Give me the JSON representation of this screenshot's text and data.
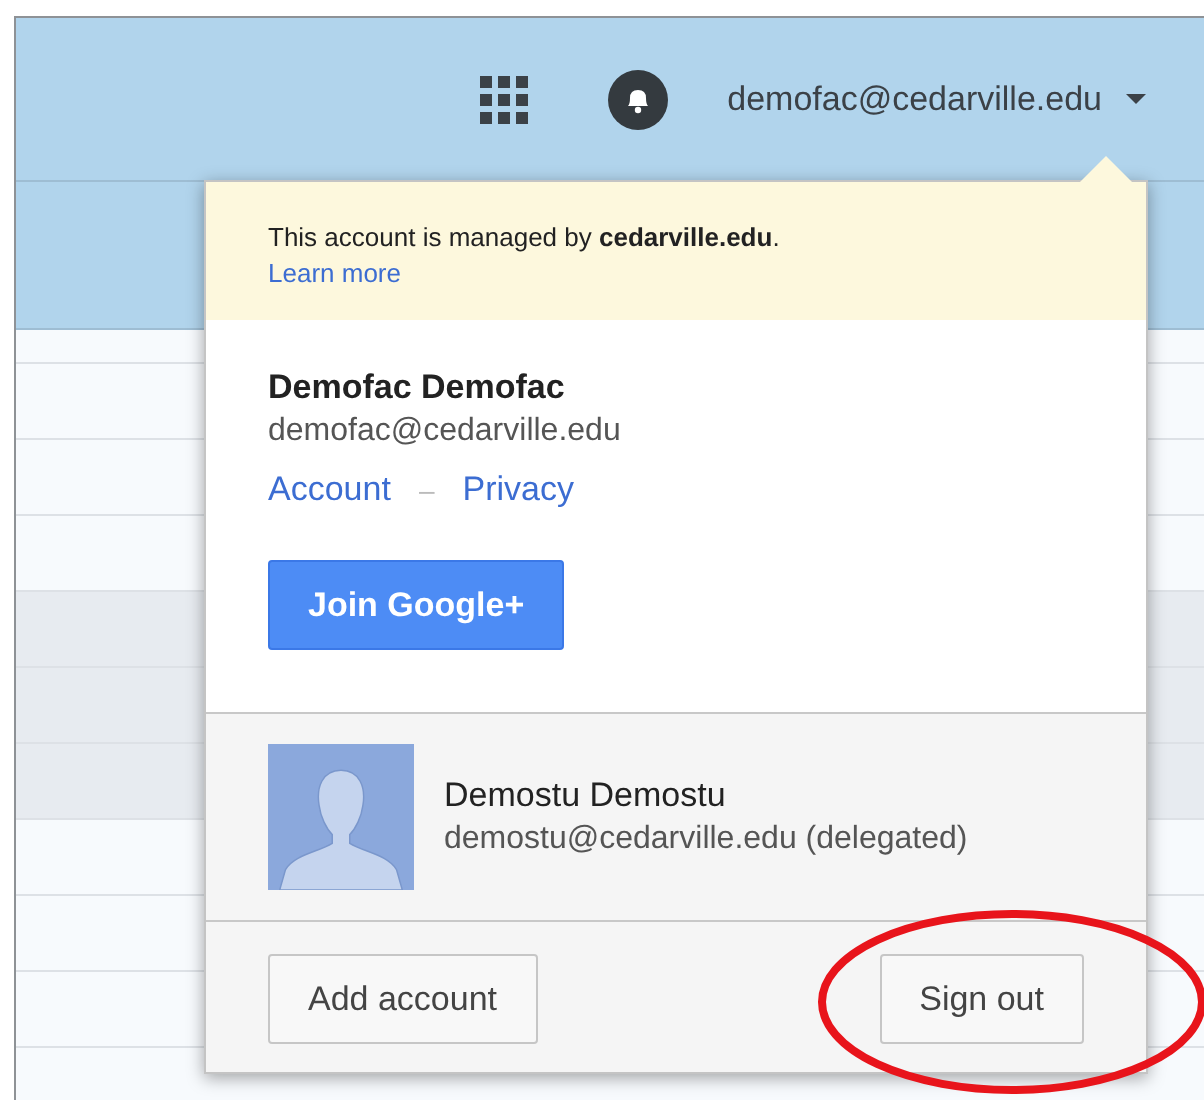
{
  "header": {
    "account_email": "demofac@cedarville.edu"
  },
  "list_rows": [
    {
      "selected": false
    },
    {
      "selected": false
    },
    {
      "selected": false
    },
    {
      "selected": true
    },
    {
      "selected": true
    },
    {
      "selected": true
    },
    {
      "selected": false
    },
    {
      "selected": false
    },
    {
      "selected": false
    },
    {
      "selected": false
    }
  ],
  "account_menu": {
    "notice": {
      "text": "This account is managed by **cedarville.edu**.",
      "link": "Learn more"
    },
    "current_account": {
      "name": "Demofac Demofac",
      "email": "demofac@cedarville.edu",
      "links": [
        "Account",
        "Privacy"
      ],
      "separator": "–",
      "button": "Join Google+"
    },
    "other_accounts": [
      {
        "name": "Demostu Demostu",
        "email": "demostu@cedarville.edu (delegated)"
      }
    ],
    "footer_buttons": [
      {
        "label": "Add account",
        "highlighted": false
      },
      {
        "label": "Sign out",
        "highlighted": true
      }
    ]
  }
}
